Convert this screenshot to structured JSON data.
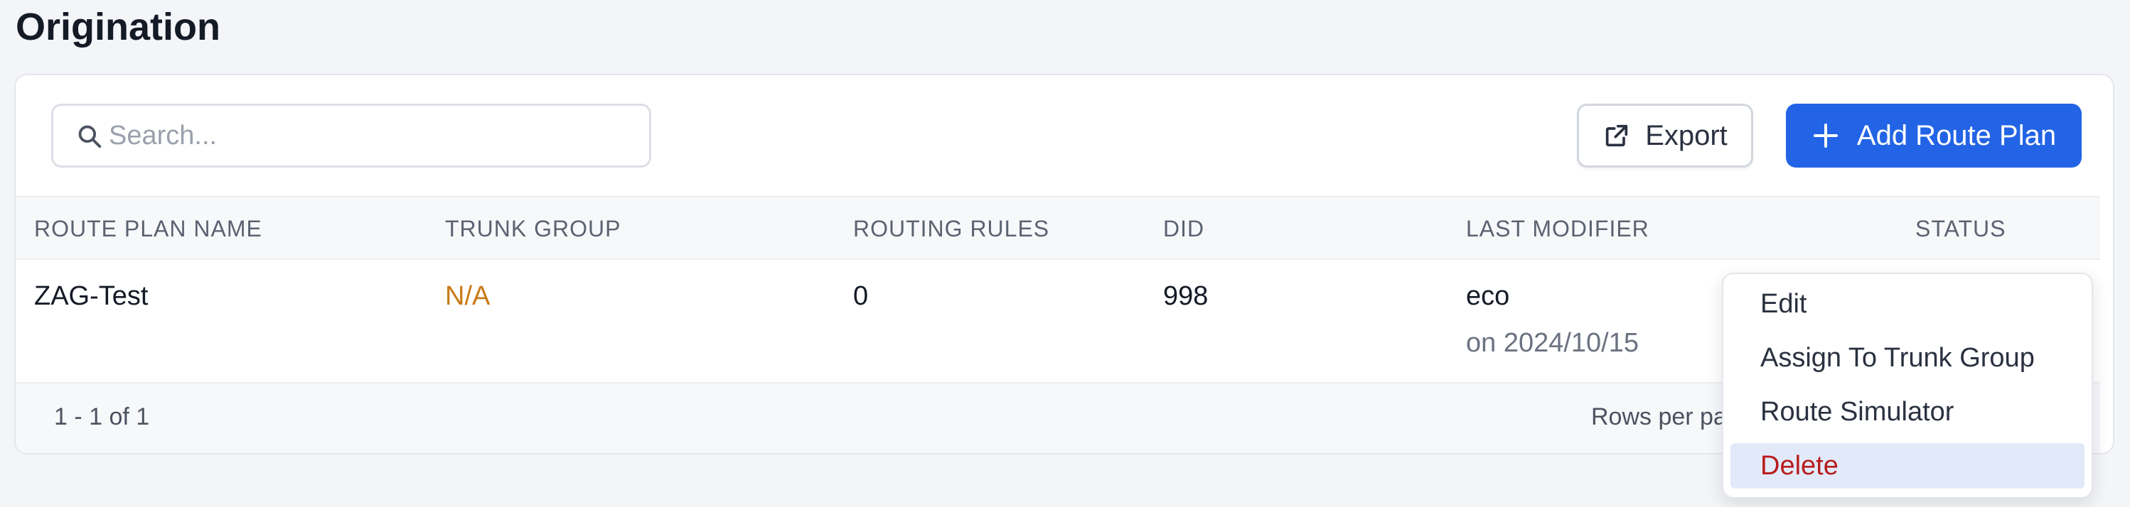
{
  "page": {
    "title": "Origination"
  },
  "toolbar": {
    "search_placeholder": "Search...",
    "search_value": "",
    "export_label": "Export",
    "add_label": "Add Route Plan"
  },
  "table": {
    "columns": [
      "ROUTE PLAN NAME",
      "TRUNK GROUP",
      "ROUTING RULES",
      "DID",
      "LAST MODIFIER",
      "STATUS"
    ],
    "rows": [
      {
        "route_plan_name": "ZAG-Test",
        "trunk_group": "N/A",
        "routing_rules": "0",
        "did": "998",
        "last_modifier": "eco",
        "modified_on": "on 2024/10/15"
      }
    ]
  },
  "footer": {
    "summary": "1 - 1 of 1",
    "rows_per_page_label": "Rows per page"
  },
  "context_menu": {
    "items": [
      {
        "label": "Edit"
      },
      {
        "label": "Assign To Trunk Group"
      },
      {
        "label": "Route Simulator"
      },
      {
        "label": "Delete"
      }
    ]
  },
  "colors": {
    "primary": "#2264e5",
    "warning_text": "#c97a16",
    "danger_text": "#b81c1c",
    "highlight_bg": "#e2eafa"
  },
  "icons": {
    "search": "search-icon",
    "export": "external-link-icon",
    "add": "plus-icon"
  }
}
